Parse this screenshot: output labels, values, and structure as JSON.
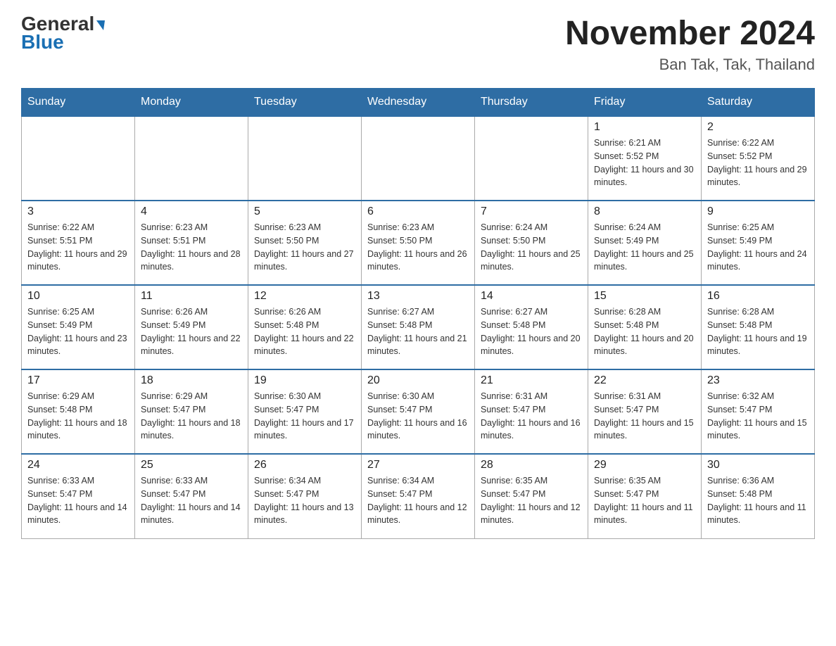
{
  "header": {
    "logo_line1": "General",
    "logo_line2": "Blue",
    "month_title": "November 2024",
    "location": "Ban Tak, Tak, Thailand"
  },
  "weekdays": [
    "Sunday",
    "Monday",
    "Tuesday",
    "Wednesday",
    "Thursday",
    "Friday",
    "Saturday"
  ],
  "weeks": [
    [
      {
        "day": "",
        "sunrise": "",
        "sunset": "",
        "daylight": ""
      },
      {
        "day": "",
        "sunrise": "",
        "sunset": "",
        "daylight": ""
      },
      {
        "day": "",
        "sunrise": "",
        "sunset": "",
        "daylight": ""
      },
      {
        "day": "",
        "sunrise": "",
        "sunset": "",
        "daylight": ""
      },
      {
        "day": "",
        "sunrise": "",
        "sunset": "",
        "daylight": ""
      },
      {
        "day": "1",
        "sunrise": "Sunrise: 6:21 AM",
        "sunset": "Sunset: 5:52 PM",
        "daylight": "Daylight: 11 hours and 30 minutes."
      },
      {
        "day": "2",
        "sunrise": "Sunrise: 6:22 AM",
        "sunset": "Sunset: 5:52 PM",
        "daylight": "Daylight: 11 hours and 29 minutes."
      }
    ],
    [
      {
        "day": "3",
        "sunrise": "Sunrise: 6:22 AM",
        "sunset": "Sunset: 5:51 PM",
        "daylight": "Daylight: 11 hours and 29 minutes."
      },
      {
        "day": "4",
        "sunrise": "Sunrise: 6:23 AM",
        "sunset": "Sunset: 5:51 PM",
        "daylight": "Daylight: 11 hours and 28 minutes."
      },
      {
        "day": "5",
        "sunrise": "Sunrise: 6:23 AM",
        "sunset": "Sunset: 5:50 PM",
        "daylight": "Daylight: 11 hours and 27 minutes."
      },
      {
        "day": "6",
        "sunrise": "Sunrise: 6:23 AM",
        "sunset": "Sunset: 5:50 PM",
        "daylight": "Daylight: 11 hours and 26 minutes."
      },
      {
        "day": "7",
        "sunrise": "Sunrise: 6:24 AM",
        "sunset": "Sunset: 5:50 PM",
        "daylight": "Daylight: 11 hours and 25 minutes."
      },
      {
        "day": "8",
        "sunrise": "Sunrise: 6:24 AM",
        "sunset": "Sunset: 5:49 PM",
        "daylight": "Daylight: 11 hours and 25 minutes."
      },
      {
        "day": "9",
        "sunrise": "Sunrise: 6:25 AM",
        "sunset": "Sunset: 5:49 PM",
        "daylight": "Daylight: 11 hours and 24 minutes."
      }
    ],
    [
      {
        "day": "10",
        "sunrise": "Sunrise: 6:25 AM",
        "sunset": "Sunset: 5:49 PM",
        "daylight": "Daylight: 11 hours and 23 minutes."
      },
      {
        "day": "11",
        "sunrise": "Sunrise: 6:26 AM",
        "sunset": "Sunset: 5:49 PM",
        "daylight": "Daylight: 11 hours and 22 minutes."
      },
      {
        "day": "12",
        "sunrise": "Sunrise: 6:26 AM",
        "sunset": "Sunset: 5:48 PM",
        "daylight": "Daylight: 11 hours and 22 minutes."
      },
      {
        "day": "13",
        "sunrise": "Sunrise: 6:27 AM",
        "sunset": "Sunset: 5:48 PM",
        "daylight": "Daylight: 11 hours and 21 minutes."
      },
      {
        "day": "14",
        "sunrise": "Sunrise: 6:27 AM",
        "sunset": "Sunset: 5:48 PM",
        "daylight": "Daylight: 11 hours and 20 minutes."
      },
      {
        "day": "15",
        "sunrise": "Sunrise: 6:28 AM",
        "sunset": "Sunset: 5:48 PM",
        "daylight": "Daylight: 11 hours and 20 minutes."
      },
      {
        "day": "16",
        "sunrise": "Sunrise: 6:28 AM",
        "sunset": "Sunset: 5:48 PM",
        "daylight": "Daylight: 11 hours and 19 minutes."
      }
    ],
    [
      {
        "day": "17",
        "sunrise": "Sunrise: 6:29 AM",
        "sunset": "Sunset: 5:48 PM",
        "daylight": "Daylight: 11 hours and 18 minutes."
      },
      {
        "day": "18",
        "sunrise": "Sunrise: 6:29 AM",
        "sunset": "Sunset: 5:47 PM",
        "daylight": "Daylight: 11 hours and 18 minutes."
      },
      {
        "day": "19",
        "sunrise": "Sunrise: 6:30 AM",
        "sunset": "Sunset: 5:47 PM",
        "daylight": "Daylight: 11 hours and 17 minutes."
      },
      {
        "day": "20",
        "sunrise": "Sunrise: 6:30 AM",
        "sunset": "Sunset: 5:47 PM",
        "daylight": "Daylight: 11 hours and 16 minutes."
      },
      {
        "day": "21",
        "sunrise": "Sunrise: 6:31 AM",
        "sunset": "Sunset: 5:47 PM",
        "daylight": "Daylight: 11 hours and 16 minutes."
      },
      {
        "day": "22",
        "sunrise": "Sunrise: 6:31 AM",
        "sunset": "Sunset: 5:47 PM",
        "daylight": "Daylight: 11 hours and 15 minutes."
      },
      {
        "day": "23",
        "sunrise": "Sunrise: 6:32 AM",
        "sunset": "Sunset: 5:47 PM",
        "daylight": "Daylight: 11 hours and 15 minutes."
      }
    ],
    [
      {
        "day": "24",
        "sunrise": "Sunrise: 6:33 AM",
        "sunset": "Sunset: 5:47 PM",
        "daylight": "Daylight: 11 hours and 14 minutes."
      },
      {
        "day": "25",
        "sunrise": "Sunrise: 6:33 AM",
        "sunset": "Sunset: 5:47 PM",
        "daylight": "Daylight: 11 hours and 14 minutes."
      },
      {
        "day": "26",
        "sunrise": "Sunrise: 6:34 AM",
        "sunset": "Sunset: 5:47 PM",
        "daylight": "Daylight: 11 hours and 13 minutes."
      },
      {
        "day": "27",
        "sunrise": "Sunrise: 6:34 AM",
        "sunset": "Sunset: 5:47 PM",
        "daylight": "Daylight: 11 hours and 12 minutes."
      },
      {
        "day": "28",
        "sunrise": "Sunrise: 6:35 AM",
        "sunset": "Sunset: 5:47 PM",
        "daylight": "Daylight: 11 hours and 12 minutes."
      },
      {
        "day": "29",
        "sunrise": "Sunrise: 6:35 AM",
        "sunset": "Sunset: 5:47 PM",
        "daylight": "Daylight: 11 hours and 11 minutes."
      },
      {
        "day": "30",
        "sunrise": "Sunrise: 6:36 AM",
        "sunset": "Sunset: 5:48 PM",
        "daylight": "Daylight: 11 hours and 11 minutes."
      }
    ]
  ]
}
